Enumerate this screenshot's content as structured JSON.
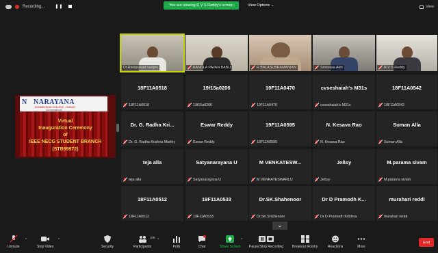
{
  "topbar": {
    "recording_label": "Recording...",
    "pause_glyph": "❚❚",
    "viewing_banner": "You are viewing R V S Reddy's screen",
    "view_options": "View Options ⌄",
    "view_label": "View"
  },
  "screenshare": {
    "logo_text": "NARAYANA",
    "logo_sub": "ENGINEERING COLLEGE :: GUDUR",
    "logo_sub2": "(AUTONOMOUS)",
    "lines": [
      "Virtual",
      "Inauguration Ceremony",
      "of",
      "IEEE NECG STUDENT BRANCH",
      "(STB99972)"
    ]
  },
  "video_tiles": [
    {
      "label": "Dr.Raviprasad varipru"
    },
    {
      "label": "KANDLA PAVAN BABU"
    },
    {
      "label": "R BALASUBRAMANIAN"
    },
    {
      "label": "Srinivasa Akili"
    },
    {
      "label": "R V S Reddy"
    }
  ],
  "name_tiles": [
    {
      "name": "18F11A0518",
      "label": "18F11A0518"
    },
    {
      "name": "19f15a0206",
      "label": "19f15a0206"
    },
    {
      "name": "19F11A0470",
      "label": "19F11A0470"
    },
    {
      "name": "cvseshaiah's M31s",
      "label": "cvseshaiah's M31s"
    },
    {
      "name": "18F11A0542",
      "label": "18F11A0542"
    },
    {
      "name": "Dr. G. Radha Kri...",
      "label": "Dr. G. Radha Krishna Murthy"
    },
    {
      "name": "Eswar Reddy",
      "label": "Eswar Reddy"
    },
    {
      "name": "19F11A0595",
      "label": "19F11A0595"
    },
    {
      "name": "N. Kesava Rao",
      "label": "N. Kesava Rao"
    },
    {
      "name": "Suman Alla",
      "label": "Suman Alla"
    },
    {
      "name": "teja alla",
      "label": "teja alla"
    },
    {
      "name": "Satyanarayana U",
      "label": "Satyanarayana U"
    },
    {
      "name": "M VENKATESW...",
      "label": "M VENKATESWARLU"
    },
    {
      "name": "Jeßsy",
      "label": "Jeßsy"
    },
    {
      "name": "M.parama sivam",
      "label": "M.parama sivam"
    },
    {
      "name": "18F11A0512",
      "label": "18F11A0512"
    },
    {
      "name": "19F11A0533",
      "label": "19F11A0533"
    },
    {
      "name": "Dr.SK.Shahenoor",
      "label": "Dr.SK.Shahenoor"
    },
    {
      "name": "Dr D Pramodh K...",
      "label": "Dr D Pramodh Krishna"
    },
    {
      "name": "murahari reddi",
      "label": "murahari reddi"
    }
  ],
  "scroll_glyph": "⌄",
  "toolbar": {
    "unmute": "Unmute",
    "stop_video": "Stop Video",
    "security": "Security",
    "participants": "Participants",
    "participants_count": "105",
    "polls": "Polls",
    "chat": "Chat",
    "share_screen": "Share Screen",
    "pause_stop_recording": "Pause/Stop Recording",
    "breakout_rooms": "Breakout Rooms",
    "reactions": "Reactions",
    "more": "More",
    "end": "End"
  },
  "colors": {
    "active_border": "#c8d400",
    "share_green": "#20a84a",
    "end_red": "#e02828",
    "mute_red": "#e02424"
  }
}
